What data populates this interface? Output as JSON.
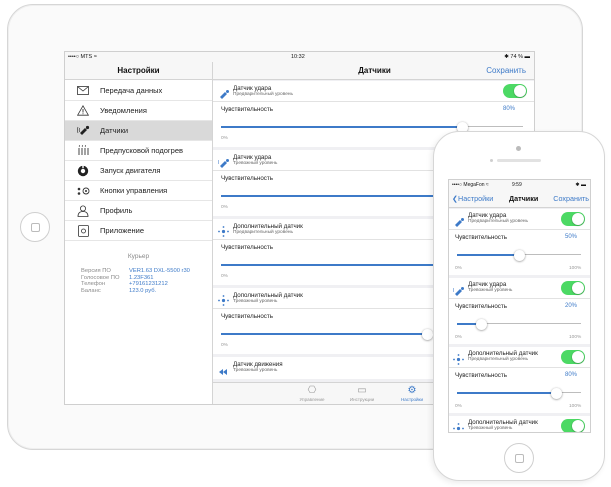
{
  "ipad": {
    "status": {
      "carrier": "••••○ MTS ≈",
      "time": "10:32",
      "battery": "✱ 74 % ▬"
    },
    "left": {
      "title": "Настройки",
      "items": [
        {
          "label": "Передача данных",
          "icon": "envelope-icon"
        },
        {
          "label": "Уведомления",
          "icon": "warning-icon"
        },
        {
          "label": "Датчики",
          "icon": "sensor-icon"
        },
        {
          "label": "Предпусковой подогрев",
          "icon": "heater-icon"
        },
        {
          "label": "Запуск двигателя",
          "icon": "engine-icon"
        },
        {
          "label": "Кнопки управления",
          "icon": "buttons-icon"
        },
        {
          "label": "Профиль",
          "icon": "person-icon"
        },
        {
          "label": "Приложение",
          "icon": "app-icon"
        }
      ],
      "courier": {
        "title": "Курьер",
        "rows": [
          {
            "k": "Версия ПО",
            "v": "VER1.63 DXL-5500 r30"
          },
          {
            "k": "Голосовое ПО",
            "v": "1.23F361"
          },
          {
            "k": "Телефон",
            "v": "+79161231212"
          },
          {
            "k": "Баланс",
            "v": "123.0 руб."
          }
        ]
      }
    },
    "right": {
      "title": "Датчики",
      "save": "Сохранить",
      "cards": [
        {
          "title": "Датчик удара",
          "sub": "Предварительный уровень",
          "label": "Чувствительность",
          "pct": "80%",
          "min": "0%",
          "value": 0.8
        },
        {
          "title": "Датчик удара",
          "sub": "Тревожный уровень",
          "label": "Чувствительность",
          "pct": "",
          "min": "0%",
          "value": 1
        },
        {
          "title": "Дополнительный датчик",
          "sub": "Предварительный уровень",
          "label": "Чувствительность",
          "pct": "",
          "min": "0%",
          "value": 1
        },
        {
          "title": "Дополнительный датчик",
          "sub": "Тревожный уровень",
          "label": "Чувствительность",
          "pct": "",
          "min": "0%",
          "value": 0.95
        },
        {
          "title": "Датчик движения",
          "sub": "Тревожный уровень"
        }
      ]
    },
    "tabs": [
      {
        "label": "Управление",
        "icon": "control-icon"
      },
      {
        "label": "Инструкции",
        "icon": "book-icon"
      },
      {
        "label": "Настройки",
        "icon": "gear-icon"
      }
    ]
  },
  "iphone": {
    "status": {
      "carrier": "••••○ MegaFon ≈",
      "time": "9:59",
      "battery": "✱ ▬"
    },
    "back": "Настройки",
    "title": "Датчики",
    "save": "Сохранить",
    "cards": [
      {
        "title": "Датчик удара",
        "sub": "Предварительный уровень",
        "label": "Чувствительность",
        "pct": "50%",
        "min": "0%",
        "max": "100%",
        "value": 0.5
      },
      {
        "title": "Датчик удара",
        "sub": "Тревожный уровень",
        "label": "Чувствительность",
        "pct": "20%",
        "min": "0%",
        "max": "100%",
        "value": 0.2
      },
      {
        "title": "Дополнительный датчик",
        "sub": "Предварительный уровень",
        "label": "Чувствительность",
        "pct": "80%",
        "min": "0%",
        "max": "100%",
        "value": 0.8
      },
      {
        "title": "Дополнительный датчик",
        "sub": "Тревожный уровень"
      }
    ]
  }
}
